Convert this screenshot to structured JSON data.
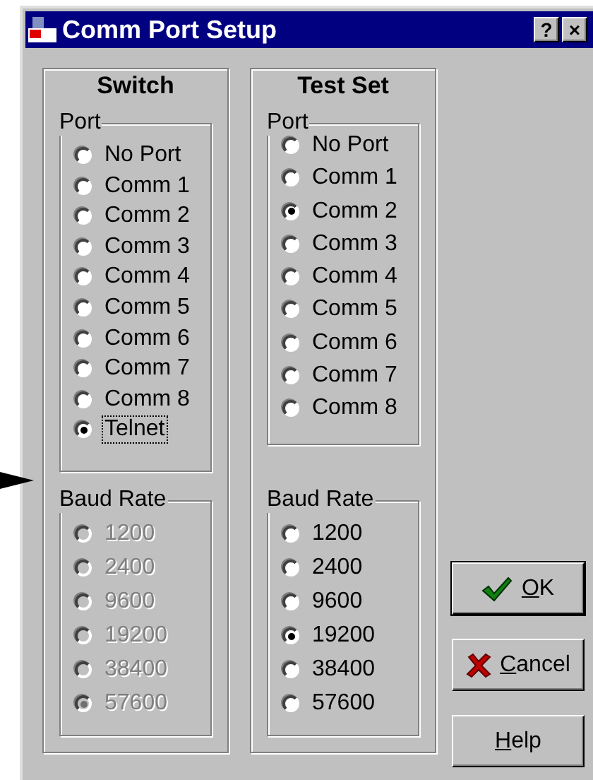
{
  "window": {
    "title": "Comm Port Setup",
    "title_buttons": [
      "?",
      "×"
    ]
  },
  "panels": [
    {
      "title": "Switch",
      "groups": [
        {
          "kind": "port",
          "label": "Port",
          "disabled": false,
          "options": [
            {
              "label": "No Port",
              "selected": false,
              "focused": false
            },
            {
              "label": "Comm 1",
              "selected": false,
              "focused": false
            },
            {
              "label": "Comm 2",
              "selected": false,
              "focused": false
            },
            {
              "label": "Comm 3",
              "selected": false,
              "focused": false
            },
            {
              "label": "Comm 4",
              "selected": false,
              "focused": false
            },
            {
              "label": "Comm 5",
              "selected": false,
              "focused": false
            },
            {
              "label": "Comm 6",
              "selected": false,
              "focused": false
            },
            {
              "label": "Comm 7",
              "selected": false,
              "focused": false
            },
            {
              "label": "Comm 8",
              "selected": false,
              "focused": false
            },
            {
              "label": "Telnet",
              "selected": true,
              "focused": true
            }
          ]
        },
        {
          "kind": "baud",
          "label": "Baud Rate",
          "disabled": true,
          "options": [
            {
              "label": "1200",
              "selected": false,
              "focused": false
            },
            {
              "label": "2400",
              "selected": false,
              "focused": false
            },
            {
              "label": "9600",
              "selected": false,
              "focused": false
            },
            {
              "label": "19200",
              "selected": false,
              "focused": false
            },
            {
              "label": "38400",
              "selected": false,
              "focused": false
            },
            {
              "label": "57600",
              "selected": true,
              "focused": false
            }
          ]
        }
      ]
    },
    {
      "title": "Test Set",
      "groups": [
        {
          "kind": "port",
          "label": "Port",
          "disabled": false,
          "options": [
            {
              "label": "No Port",
              "selected": false,
              "focused": false
            },
            {
              "label": "Comm 1",
              "selected": false,
              "focused": false
            },
            {
              "label": "Comm 2",
              "selected": true,
              "focused": false
            },
            {
              "label": "Comm 3",
              "selected": false,
              "focused": false
            },
            {
              "label": "Comm 4",
              "selected": false,
              "focused": false
            },
            {
              "label": "Comm 5",
              "selected": false,
              "focused": false
            },
            {
              "label": "Comm 6",
              "selected": false,
              "focused": false
            },
            {
              "label": "Comm 7",
              "selected": false,
              "focused": false
            },
            {
              "label": "Comm 8",
              "selected": false,
              "focused": false
            }
          ]
        },
        {
          "kind": "baud",
          "label": "Baud Rate",
          "disabled": false,
          "options": [
            {
              "label": "1200",
              "selected": false,
              "focused": false
            },
            {
              "label": "2400",
              "selected": false,
              "focused": false
            },
            {
              "label": "9600",
              "selected": false,
              "focused": false
            },
            {
              "label": "19200",
              "selected": true,
              "focused": false
            },
            {
              "label": "38400",
              "selected": false,
              "focused": false
            },
            {
              "label": "57600",
              "selected": false,
              "focused": false
            }
          ]
        }
      ]
    }
  ],
  "buttons": [
    {
      "kind": "ok",
      "label": "OK",
      "default": true
    },
    {
      "kind": "cancel",
      "label": "Cancel",
      "default": false
    },
    {
      "kind": "help",
      "label": "Help",
      "default": false
    }
  ]
}
